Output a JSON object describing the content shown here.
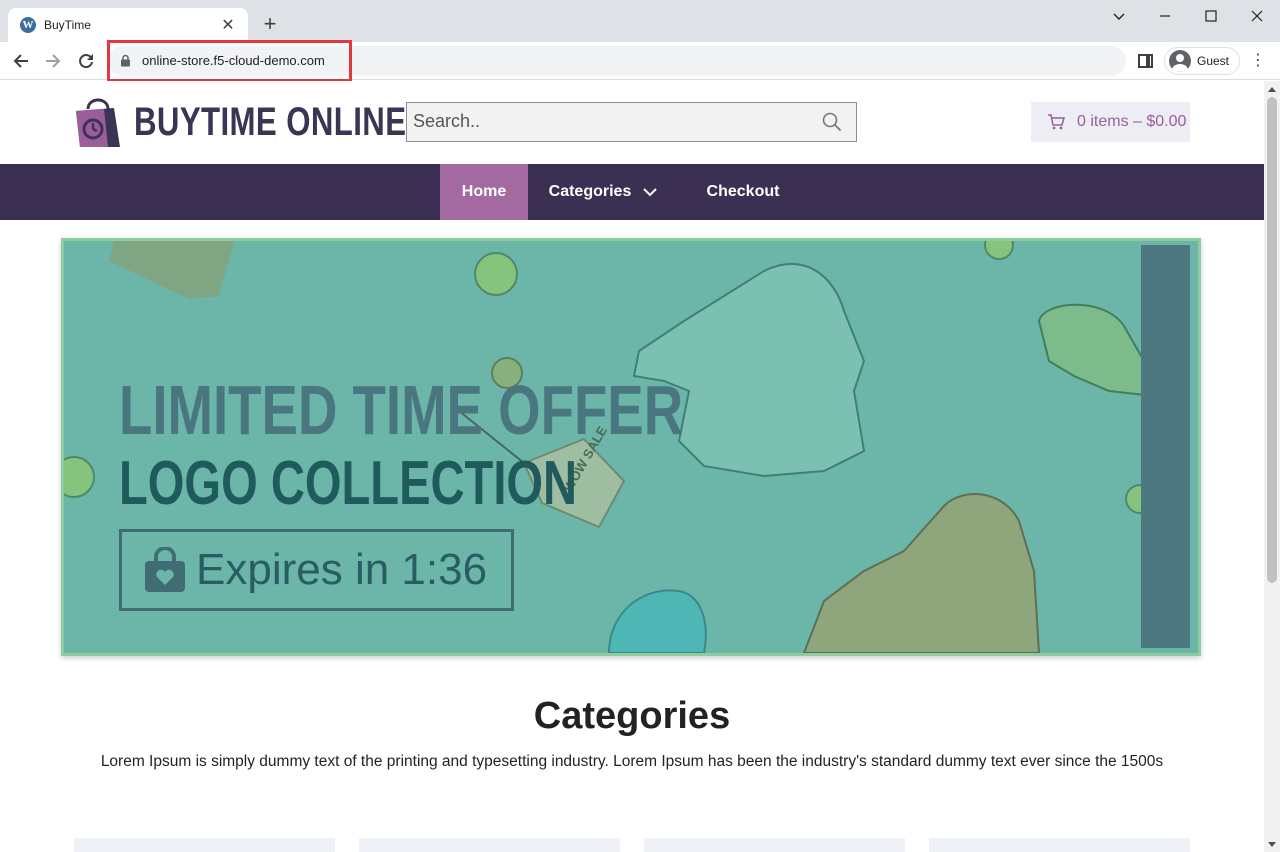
{
  "browser": {
    "tab_title": "BuyTime",
    "tab_favicon_letter": "W",
    "url": "online-store.f5-cloud-demo.com",
    "profile_name": "Guest",
    "icons": [
      "wordpress-favicon",
      "close-icon",
      "plus-icon",
      "chevron-down-icon",
      "minimize-icon",
      "maximize-icon",
      "close-window-icon",
      "back-icon",
      "forward-icon",
      "reload-icon",
      "lock-icon",
      "side-panel-icon",
      "avatar-icon",
      "kebab-menu-icon"
    ]
  },
  "site": {
    "logo_text": "BUYTIME ONLINE",
    "search_placeholder": "Search..",
    "cart_label": "0 items – $0.00",
    "nav": {
      "home": "Home",
      "categories": "Categories",
      "checkout": "Checkout"
    },
    "banner": {
      "headline": "LIMITED TIME OFFER",
      "subheadline": "LOGO COLLECTION",
      "expires": "Expires in 1:36",
      "tag_text": "WOW SALE"
    },
    "categories": {
      "heading": "Categories",
      "description": "Lorem Ipsum is simply dummy text of the printing and typesetting industry. Lorem Ipsum has been the industry's standard dummy text ever since the 1500s"
    }
  },
  "colors": {
    "nav_bg": "#3b3054",
    "nav_active": "#a26aa1",
    "logo_text": "#3b3454",
    "banner_bg": "#6bb6a8",
    "cart_text": "#9b5d9c",
    "highlight_box": "#e0383e"
  }
}
